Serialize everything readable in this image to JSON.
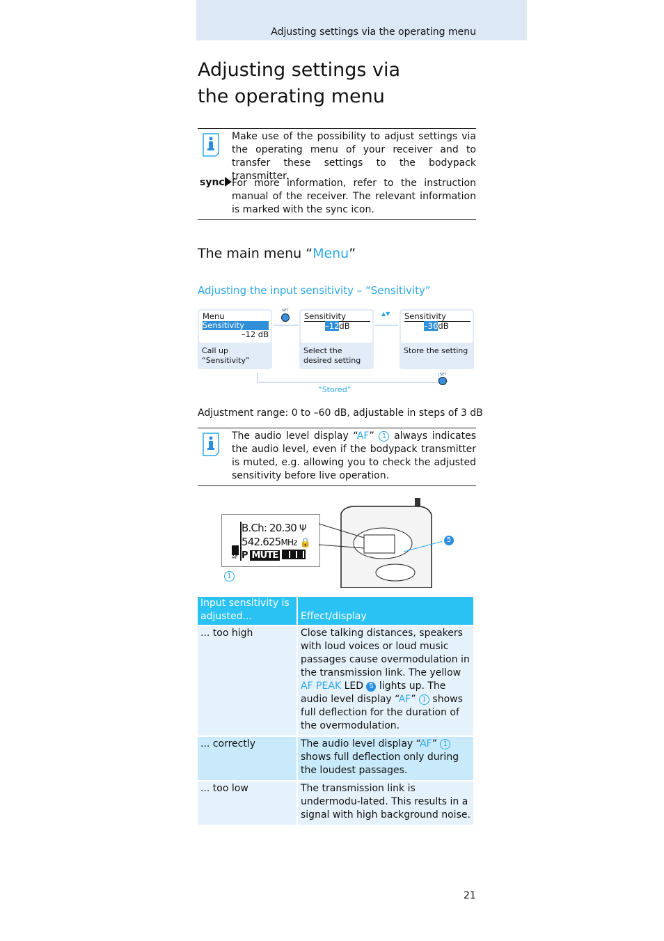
{
  "header": {
    "running_title": "Adjusting settings via the operating menu"
  },
  "title": "Adjusting settings via the operating menu",
  "notes": {
    "info1": "Make use of the possibility to adjust settings via the operating menu of your receiver and to transfer these settings to the bodypack transmitter.",
    "sync_label": "sync",
    "sync": "For more information, refer to the instruction manual of the receiver. The relevant information is marked with the sync icon."
  },
  "section": {
    "prefix": "The main menu “",
    "menu": "Menu",
    "suffix": "”"
  },
  "subsection": "Adjusting the input sensitivity – “Sensitivity”",
  "diagram": {
    "step1": {
      "line1": "Menu",
      "line2": "Sensitivity",
      "line3": "–12 dB",
      "cap1": "Call up",
      "cap2": "“Sensitivity”"
    },
    "step2": {
      "line1": "Sensitivity",
      "value": "–12",
      "unit": "dB",
      "cap": "Select the desired setting"
    },
    "step3": {
      "line1": "Sensitivity",
      "value": "–36",
      "unit": "dB",
      "cap": "Store the setting"
    },
    "set_label": "SET",
    "updown": "▲▼",
    "stored": "“Stored”"
  },
  "range": "Adjustment range: 0 to –60 dB, adjustable in steps of 3 dB",
  "info2": {
    "a": "The audio level display “",
    "af": "AF",
    "b": "”",
    "num": "1",
    "c": " always indicates the audio level, even if the bodypack transmitter is muted, e.g. allowing you to check the adjusted sensitivity before live operation."
  },
  "display": {
    "ch": "B.Ch: 20.30",
    "freq": "542.625",
    "mhz": "MHz",
    "p": "P",
    "mute": "MUTE",
    "af": "AF",
    "callout1": "1",
    "callout5": "5"
  },
  "table": {
    "headers": [
      "Input sensitivity is adjusted...",
      "Effect/display"
    ],
    "rows": [
      {
        "col1": "... too high",
        "a": "Close talking distances, speakers with loud voices or loud music passages cause overmodulation in the transmission link. The yellow ",
        "afpeak": "AF PEAK",
        "b": " LED ",
        "n5": "5",
        "c": " lights up. The audio level display “",
        "af": "AF",
        "d": "” ",
        "n1": "1",
        "e": " shows full deflection for the duration of the overmodulation."
      },
      {
        "col1": "... correctly",
        "a": "The audio level display “",
        "af": "AF",
        "b": "” ",
        "n1": "1",
        "c": " shows full deflection only during the loudest passages."
      },
      {
        "col1": "... too low",
        "a": "The transmission link is undermodu-lated. This results in a signal with high background noise."
      }
    ]
  },
  "page_number": "21",
  "colors": {
    "accent": "#2aa7e8",
    "table_header": "#2ac1f3",
    "header_band": "#dde8f6"
  }
}
